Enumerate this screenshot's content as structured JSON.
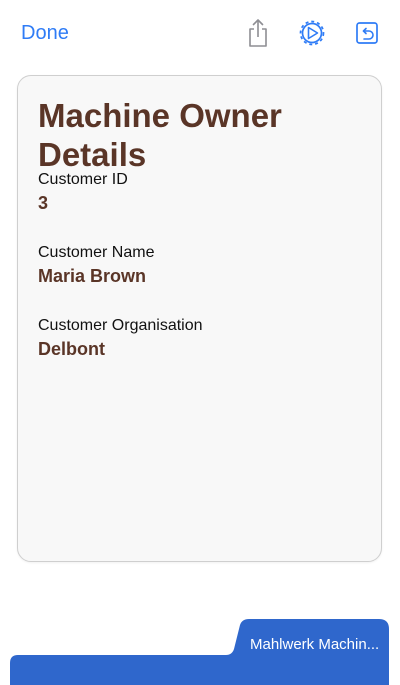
{
  "toolbar": {
    "done_label": "Done",
    "icons": [
      "share-icon",
      "gear-icon",
      "back-icon"
    ],
    "accent_color": "#2f7cf6"
  },
  "card": {
    "title": "Machine Owner Details",
    "fields": [
      {
        "label": "Customer ID",
        "value": "3"
      },
      {
        "label": "Customer Name",
        "value": "Maria Brown"
      },
      {
        "label": "Customer Organisation",
        "value": "Delbont"
      }
    ],
    "title_color": "#5a3527",
    "value_color": "#5a3527"
  },
  "bottom_tab": {
    "label": "Mahlwerk Machin...",
    "color": "#2f67cc"
  }
}
